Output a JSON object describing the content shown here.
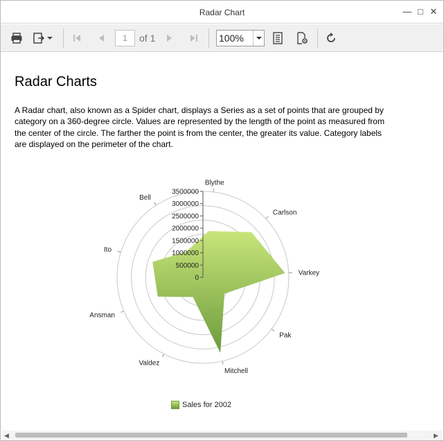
{
  "window": {
    "title": "Radar Chart"
  },
  "toolbar": {
    "page_value": "1",
    "page_of": "of 1",
    "zoom": "100%"
  },
  "document": {
    "heading": "Radar Charts",
    "paragraph": "A Radar chart, also known as a Spider chart, displays a Series as a set of points that are grouped by category on a 360-degree circle. Values are represented by the length of the point as measured from the center of the circle. The farther the point is from the center, the greater its value. Category labels are displayed on the perimeter of the chart."
  },
  "chart_data": {
    "type": "radar",
    "title": "",
    "categories": [
      "Blythe",
      "Carlson",
      "Varkey",
      "Pak",
      "Mitchell",
      "Valdez",
      "Ansman",
      "Ito",
      "Bell"
    ],
    "series": [
      {
        "name": "Sales for 2002",
        "values": [
          1900000,
          2700000,
          3350000,
          1100000,
          3150000,
          900000,
          2000000,
          2150000,
          1250000
        ]
      }
    ],
    "value_ticks": [
      "3500000",
      "3000000",
      "2500000",
      "2000000",
      "1500000",
      "1000000",
      "500000",
      "0"
    ],
    "ylim": [
      0,
      3500000
    ],
    "legend_position": "bottom",
    "colors": {
      "fill_top": "#c8e57a",
      "fill_bottom": "#6c9b3c",
      "grid": "#c8c8c8"
    }
  },
  "icons": {
    "print": "printer-icon",
    "export": "export-icon",
    "first": "first-page-icon",
    "prev": "previous-page-icon",
    "next": "next-page-icon",
    "last": "last-page-icon",
    "zoom": "zoom-dropdown-icon",
    "view": "single-page-view-icon",
    "settings": "page-settings-icon",
    "refresh": "refresh-icon"
  }
}
